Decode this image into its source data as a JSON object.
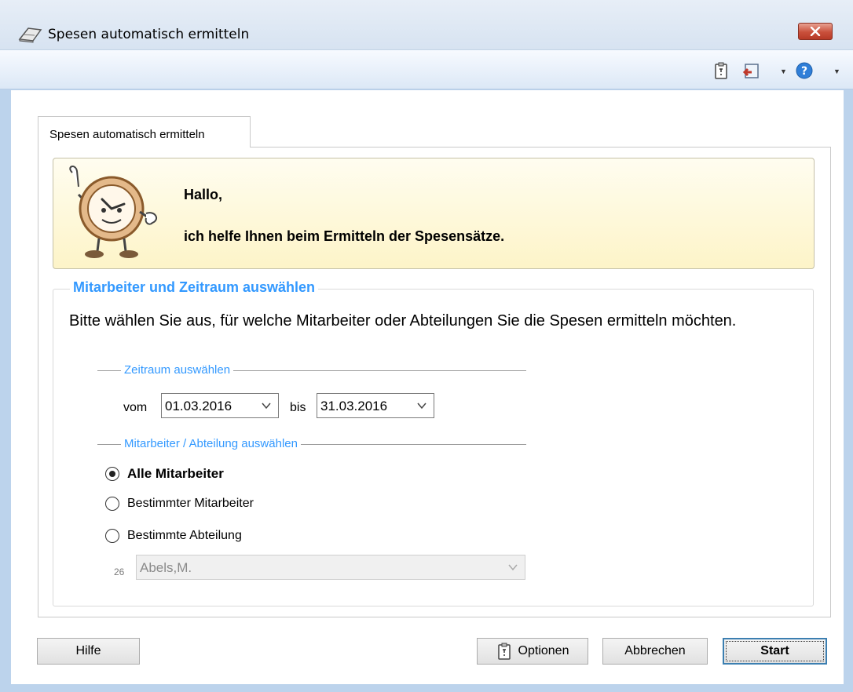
{
  "window": {
    "title": "Spesen automatisch ermitteln",
    "close_icon": "close-icon"
  },
  "toolbar": {
    "icons": [
      "clipboard-icon",
      "exit-icon",
      "help-icon"
    ]
  },
  "tab": {
    "label": "Spesen automatisch ermitteln"
  },
  "banner": {
    "greeting": "Hallo,",
    "message": "ich helfe Ihnen beim Ermitteln der Spesensätze."
  },
  "group": {
    "title": "Mitarbeiter und Zeitraum auswählen",
    "instruction": "Bitte wählen Sie aus, für welche Mitarbeiter oder Abteilungen Sie die Spesen ermitteln möchten."
  },
  "period": {
    "title": "Zeitraum auswählen",
    "from_label": "vom",
    "from_value": "01.03.2016",
    "to_label": "bis",
    "to_value": "31.03.2016"
  },
  "selection": {
    "title": "Mitarbeiter / Abteilung auswählen",
    "options": [
      {
        "label": "Alle Mitarbeiter",
        "checked": true
      },
      {
        "label": "Bestimmter Mitarbeiter",
        "checked": false
      },
      {
        "label": "Bestimmte Abteilung",
        "checked": false
      }
    ],
    "employee_number": "26",
    "employee_value": "Abels,M."
  },
  "buttons": {
    "help": "Hilfe",
    "options": "Optionen",
    "cancel": "Abbrechen",
    "start": "Start"
  },
  "colors": {
    "accent": "#3399ff",
    "banner_bg": "#fdf4c8",
    "close_button": "#c9503b"
  }
}
